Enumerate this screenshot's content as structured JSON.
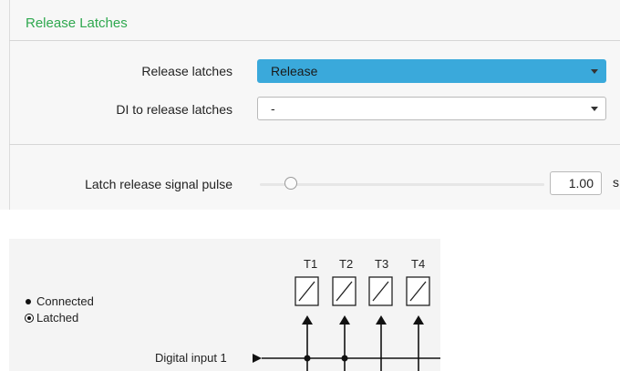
{
  "section": {
    "title": "Release Latches"
  },
  "release_latches": {
    "label": "Release latches",
    "value": "Release"
  },
  "di_release": {
    "label": "DI to release latches",
    "value": "-"
  },
  "pulse": {
    "label": "Latch release signal pulse",
    "value": "1.00",
    "unit": "s"
  },
  "diagram": {
    "terminals": [
      "T1",
      "T2",
      "T3",
      "T4"
    ],
    "legend": {
      "connected": "Connected",
      "latched": "Latched"
    },
    "input_label": "Digital input 1"
  },
  "icons": [
    "chevron-down-icon",
    "slider-handle",
    "arrow-right-icon",
    "arrow-up-icon",
    "relay-contact-icon"
  ]
}
